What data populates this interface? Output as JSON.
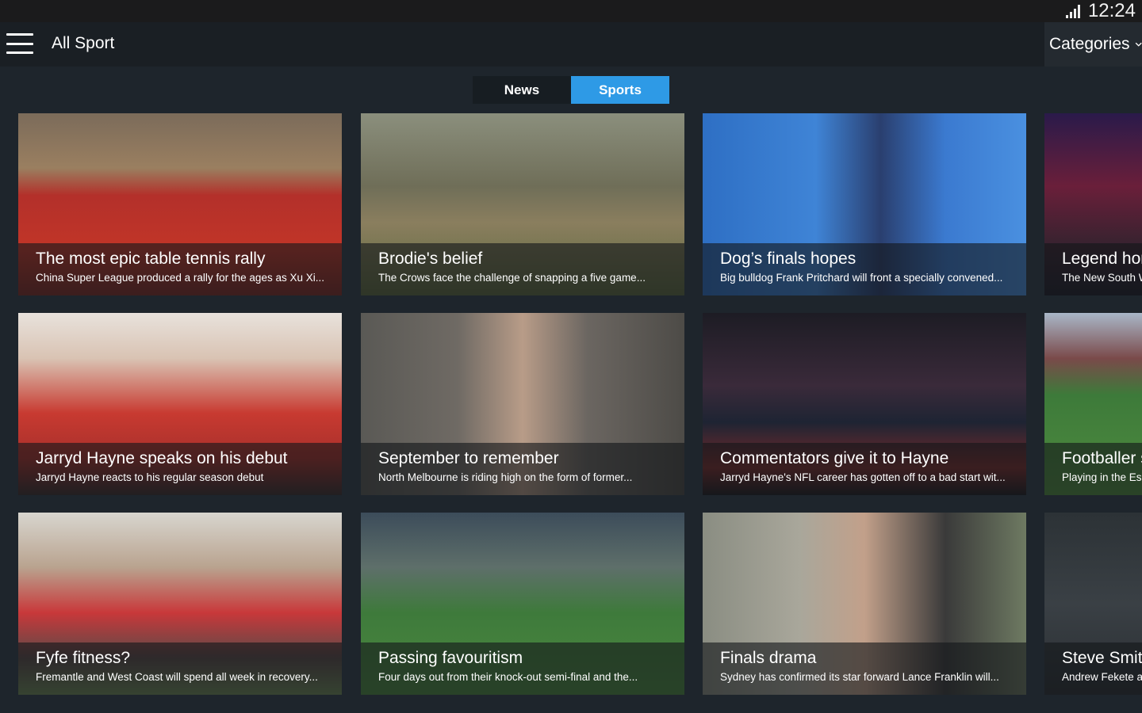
{
  "status_bar": {
    "time": "12:24",
    "signal_icon": "signal-icon"
  },
  "app_bar": {
    "title": "All Sport",
    "categories_label": "Categories",
    "menu_icon": "hamburger-menu-icon"
  },
  "tabs": [
    {
      "label": "News",
      "selected": false
    },
    {
      "label": "Sports",
      "selected": true
    }
  ],
  "colors": {
    "accent": "#2e9ae6",
    "background": "#1e252c",
    "app_bar": "#1a1f24"
  },
  "cards": [
    {
      "title": "The most epic table tennis rally",
      "desc": "China Super League produced a rally for the ages as Xu Xi..."
    },
    {
      "title": "Brodie's belief",
      "desc": "The Crows face the challenge of snapping a five game..."
    },
    {
      "title": "Dog’s finals hopes",
      "desc": "Big bulldog Frank Pritchard will front a specially convened..."
    },
    {
      "title": "Legend hon",
      "desc": "The New South W"
    },
    {
      "title": "Jarryd Hayne speaks on his debut",
      "desc": "Jarryd Hayne reacts to his regular season debut"
    },
    {
      "title": "September to remember",
      "desc": "North Melbourne is riding high on the form of former..."
    },
    {
      "title": "Commentators give it to Hayne",
      "desc": "Jarryd Hayne's NFL career has gotten off to a bad start wit..."
    },
    {
      "title": "Footballer s",
      "desc": "Playing in the Es"
    },
    {
      "title": "Fyfe fitness?",
      "desc": "Fremantle and West Coast will spend all week in recovery..."
    },
    {
      "title": "Passing favouritism",
      "desc": "Four days out from their knock-out semi-final and the..."
    },
    {
      "title": "Finals drama",
      "desc": "Sydney has confirmed its star forward Lance Franklin will..."
    },
    {
      "title": "Steve Smit",
      "desc": "Andrew Fekete a"
    }
  ]
}
